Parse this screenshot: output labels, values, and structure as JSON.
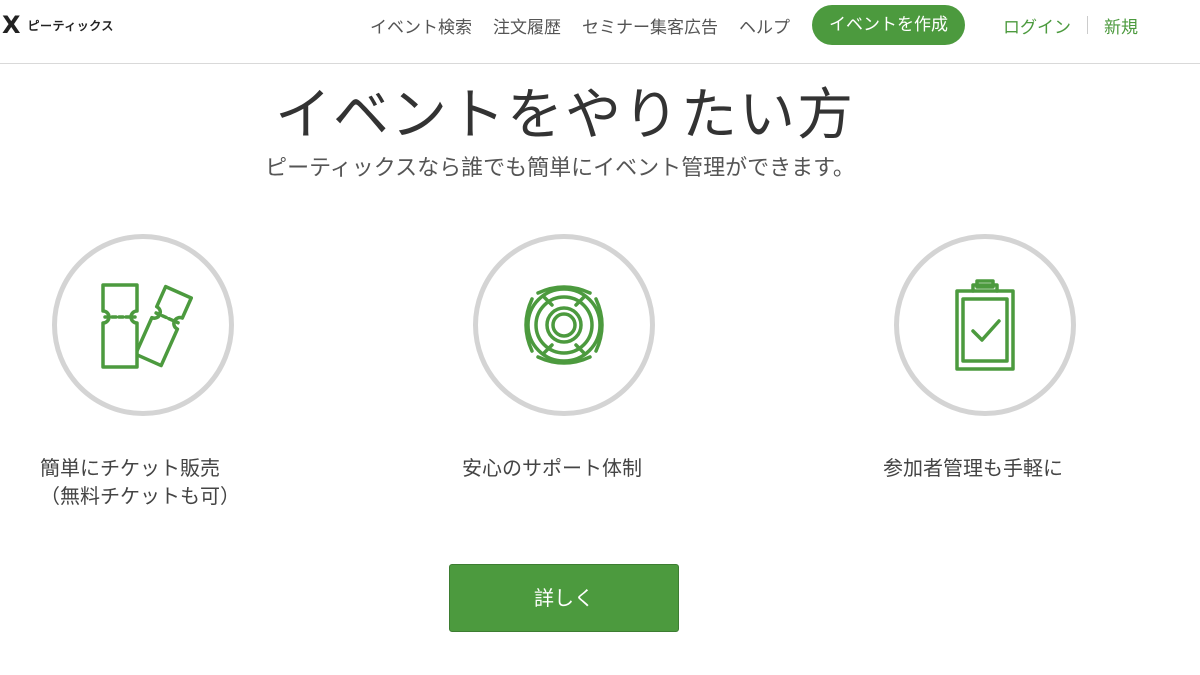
{
  "header": {
    "logo_mark": "X",
    "logo_text": "ピーティックス",
    "nav": [
      "イベント検索",
      "注文履歴",
      "セミナー集客広告",
      "ヘルプ"
    ],
    "create_button": "イベントを作成",
    "login": "ログイン",
    "signup": "新規"
  },
  "hero": {
    "title": "イベントをやりたい方",
    "subtitle": "ピーティックスなら誰でも簡単にイベント管理ができます。"
  },
  "features": [
    {
      "icon": "ticket-icon",
      "line1": "簡単にチケット販売",
      "line2": "（無料チケットも可）"
    },
    {
      "icon": "lifebuoy-icon",
      "line1": "安心のサポート体制"
    },
    {
      "icon": "clipboard-check-icon",
      "line1": "参加者管理も手軽に"
    }
  ],
  "details_button": "詳しく",
  "colors": {
    "accent": "#4c9a3e",
    "circle_border": "#d4d4d4",
    "text": "#333333"
  }
}
